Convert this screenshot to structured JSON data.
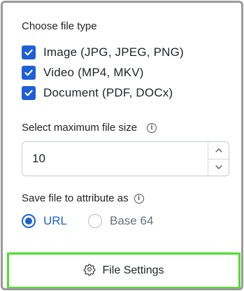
{
  "file_type": {
    "title": "Choose file type",
    "options": [
      {
        "label": "Image (JPG, JPEG, PNG)",
        "checked": true
      },
      {
        "label": "Video (MP4, MKV)",
        "checked": true
      },
      {
        "label": "Document (PDF, DOCx)",
        "checked": true
      }
    ]
  },
  "max_size": {
    "label": "Select maximum file size",
    "value": "10",
    "info_icon": "info-icon"
  },
  "save_as": {
    "label": "Save file to attribute as",
    "info_icon": "info-icon",
    "options": [
      {
        "label": "URL",
        "selected": true
      },
      {
        "label": "Base 64",
        "selected": false
      }
    ]
  },
  "footer": {
    "button_label": "File Settings",
    "icon": "gear-icon"
  },
  "colors": {
    "accent": "#1f5fd6",
    "highlight": "#4ee02d",
    "border": "#9a9a9a"
  }
}
